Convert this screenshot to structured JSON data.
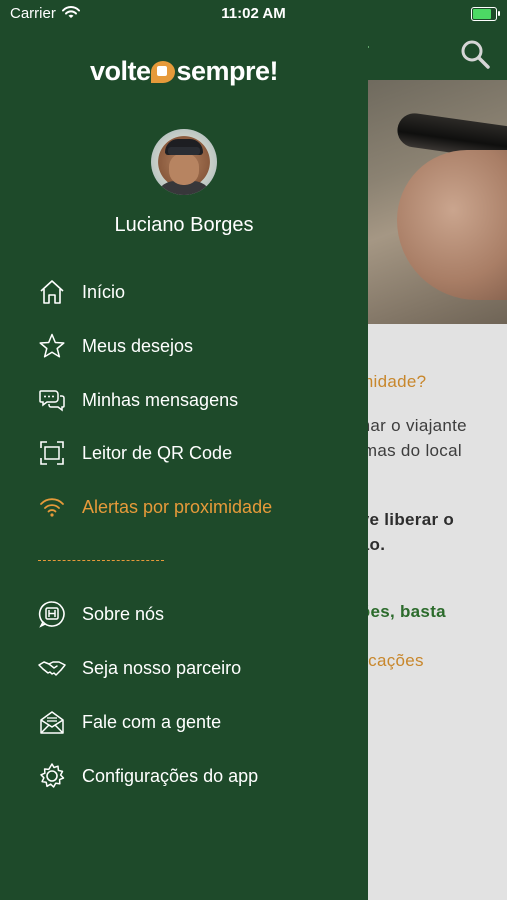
{
  "status_bar": {
    "carrier": "Carrier",
    "time": "11:02 AM"
  },
  "drawer": {
    "logo": {
      "left": "volte",
      "right": "sempre!"
    },
    "user_name": "Luciano Borges",
    "menu_primary": [
      {
        "label": "Início",
        "icon": "home-icon"
      },
      {
        "label": "Meus desejos",
        "icon": "star-icon"
      },
      {
        "label": "Minhas mensagens",
        "icon": "chat-bubbles-icon"
      },
      {
        "label": "Leitor de QR Code",
        "icon": "qr-scan-icon"
      },
      {
        "label": "Alertas por proximidade",
        "icon": "wifi-signal-icon",
        "active": true
      }
    ],
    "menu_secondary": [
      {
        "label": "Sobre nós",
        "icon": "brand-badge-icon"
      },
      {
        "label": "Seja nosso parceiro",
        "icon": "handshake-icon"
      },
      {
        "label": "Fale com a gente",
        "icon": "envelope-icon"
      },
      {
        "label": "Configurações do app",
        "icon": "gear-icon"
      }
    ]
  },
  "background_page": {
    "heading_fragment": "imidade?",
    "line1": "rmar o viajante",
    "line2": "ximas do local",
    "line3": "eve liberar o",
    "line4": "ção.",
    "line5": "ções, basta",
    "line6": "ificações"
  },
  "colors": {
    "drawer_bg": "#1e4a2a",
    "accent_orange": "#e69a3a",
    "text_white": "#ffffff"
  }
}
